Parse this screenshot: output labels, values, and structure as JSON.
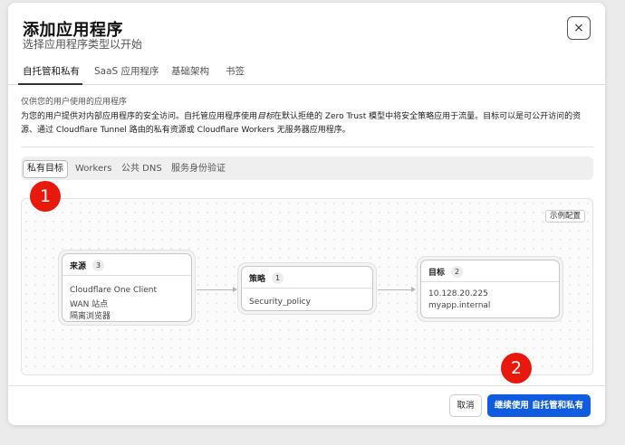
{
  "dialog": {
    "title": "添加应用程序",
    "subtitle": "选择应用程序类型以开始",
    "close_icon": "×"
  },
  "tabs": [
    {
      "label": "自托管和私有",
      "active": true
    },
    {
      "label": "SaaS 应用程序",
      "active": false
    },
    {
      "label": "基础架构",
      "active": false
    },
    {
      "label": "书签",
      "active": false
    }
  ],
  "description": {
    "label": "仅供您的用户使用的应用程序",
    "text_before": "为您的用户提供对内部应用程序的安全访问。自托管应用程序使用",
    "text_emphasis": "目标",
    "text_after": "在默认拒绝的 Zero Trust 模型中将安全策略应用于流量。目标可以是可公开访问的资源、通过 Cloudflare Tunnel 路由的私有资源或 Cloudflare Workers 无服务器应用程序。"
  },
  "segments": [
    {
      "label": "私有目标",
      "active": true
    },
    {
      "label": "Workers",
      "active": false
    },
    {
      "label": "公共 DNS",
      "active": false
    },
    {
      "label": "服务身份验证",
      "active": false
    }
  ],
  "flow": {
    "example_button": "示例配置",
    "source": {
      "title": "来源",
      "count": "3",
      "lines": [
        "Cloudflare One Client",
        "WAN 站点",
        "隔离浏览器"
      ]
    },
    "policy": {
      "title": "策略",
      "count": "1",
      "lines": [
        "Security_policy"
      ]
    },
    "target": {
      "title": "目标",
      "count": "2",
      "lines": [
        "10.128.20.225",
        "myapp.internal"
      ]
    }
  },
  "footer": {
    "cancel": "取消",
    "continue": "继续使用 自托管和私有"
  },
  "markers": [
    "1",
    "2"
  ],
  "colors": {
    "primary": "#0f5ce0",
    "marker": "#e8180c"
  }
}
